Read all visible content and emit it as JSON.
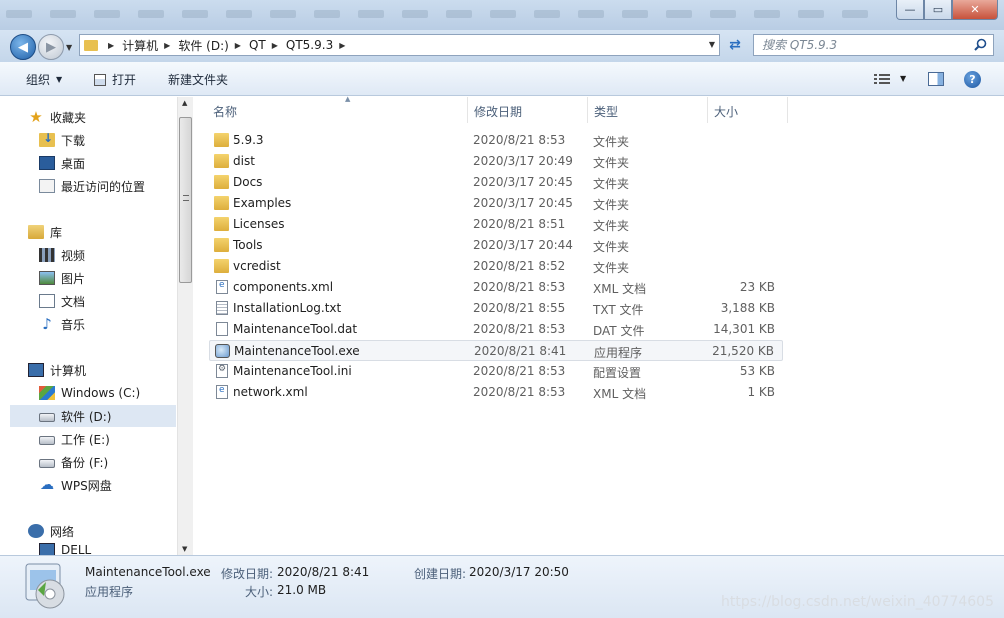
{
  "window": {
    "minimize_icon": "minimize-icon",
    "maximize_icon": "maximize-icon",
    "close_icon": "close-icon"
  },
  "address": {
    "crumbs": [
      "计算机",
      "软件 (D:)",
      "QT",
      "QT5.9.3"
    ]
  },
  "search": {
    "placeholder": "搜索 QT5.9.3"
  },
  "toolbar": {
    "organize": "组织",
    "open": "打开",
    "new_folder": "新建文件夹"
  },
  "nav": {
    "favorites": "收藏夹",
    "downloads": "下载",
    "desktop": "桌面",
    "recent": "最近访问的位置",
    "libraries": "库",
    "videos": "视频",
    "pictures": "图片",
    "documents": "文档",
    "music": "音乐",
    "computer": "计算机",
    "drive_c": "Windows (C:)",
    "drive_d": "软件 (D:)",
    "drive_e": "工作 (E:)",
    "drive_f": "备份 (F:)",
    "wps": "WPS网盘",
    "network": "网络",
    "dell": "DELL"
  },
  "columns": {
    "name": "名称",
    "date": "修改日期",
    "type": "类型",
    "size": "大小"
  },
  "files": [
    {
      "name": "5.9.3",
      "date": "2020/8/21 8:53",
      "type": "文件夹",
      "size": "",
      "icon": "folder"
    },
    {
      "name": "dist",
      "date": "2020/3/17 20:49",
      "type": "文件夹",
      "size": "",
      "icon": "folder"
    },
    {
      "name": "Docs",
      "date": "2020/3/17 20:45",
      "type": "文件夹",
      "size": "",
      "icon": "folder"
    },
    {
      "name": "Examples",
      "date": "2020/3/17 20:45",
      "type": "文件夹",
      "size": "",
      "icon": "folder"
    },
    {
      "name": "Licenses",
      "date": "2020/8/21 8:51",
      "type": "文件夹",
      "size": "",
      "icon": "folder"
    },
    {
      "name": "Tools",
      "date": "2020/3/17 20:44",
      "type": "文件夹",
      "size": "",
      "icon": "folder"
    },
    {
      "name": "vcredist",
      "date": "2020/8/21 8:52",
      "type": "文件夹",
      "size": "",
      "icon": "folder"
    },
    {
      "name": "components.xml",
      "date": "2020/8/21 8:53",
      "type": "XML 文档",
      "size": "23 KB",
      "icon": "xml"
    },
    {
      "name": "InstallationLog.txt",
      "date": "2020/8/21 8:55",
      "type": "TXT 文件",
      "size": "3,188 KB",
      "icon": "txt"
    },
    {
      "name": "MaintenanceTool.dat",
      "date": "2020/8/21 8:53",
      "type": "DAT 文件",
      "size": "14,301 KB",
      "icon": "file"
    },
    {
      "name": "MaintenanceTool.exe",
      "date": "2020/8/21 8:41",
      "type": "应用程序",
      "size": "21,520 KB",
      "icon": "exe"
    },
    {
      "name": "MaintenanceTool.ini",
      "date": "2020/8/21 8:53",
      "type": "配置设置",
      "size": "53 KB",
      "icon": "ini"
    },
    {
      "name": "network.xml",
      "date": "2020/8/21 8:53",
      "type": "XML 文档",
      "size": "1 KB",
      "icon": "xml"
    }
  ],
  "selected_index": 10,
  "details": {
    "filename": "MaintenanceTool.exe",
    "kind": "应用程序",
    "modified_label": "修改日期:",
    "modified_value": "2020/8/21 8:41",
    "created_label": "创建日期:",
    "created_value": "2020/3/17 20:50",
    "size_label": "大小:",
    "size_value": "21.0 MB"
  },
  "watermark": "https://blog.csdn.net/weixin_40774605"
}
